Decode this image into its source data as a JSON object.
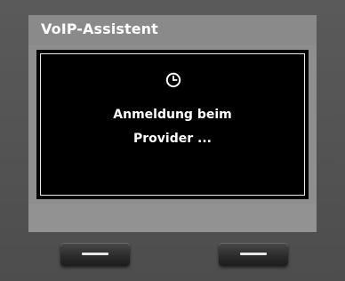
{
  "header": {
    "title": "VoIP-Assistent"
  },
  "dialog": {
    "icon": "clock-icon",
    "message_line1": "Anmeldung beim",
    "message_line2": "Provider ..."
  },
  "softkeys": {
    "left_icon": "dash-icon",
    "right_icon": "dash-icon"
  },
  "colors": {
    "bezel": "#535353",
    "screen_gray": "#8e8e8e",
    "dialog_background": "#000000",
    "text": "#ffffff"
  }
}
